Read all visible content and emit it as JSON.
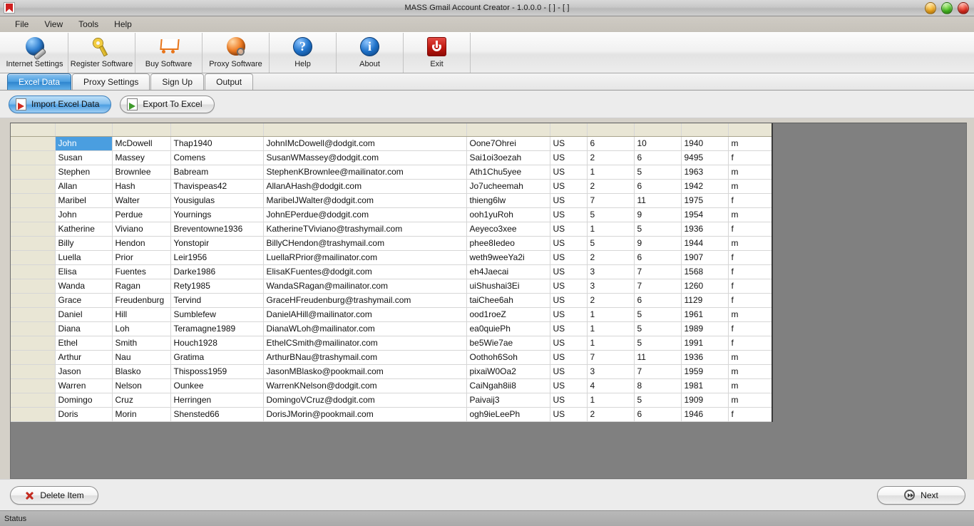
{
  "window": {
    "title": "MASS Gmail Account Creator - 1.0.0.0 - [ ] - [ ]",
    "app_icon": "gmail-envelope-icon",
    "controls": [
      {
        "name": "minimize-button",
        "color": "#f2a81c"
      },
      {
        "name": "maximize-button",
        "color": "#43bc1e"
      },
      {
        "name": "close-button",
        "color": "#e02a1c"
      }
    ]
  },
  "menubar": {
    "items": [
      {
        "label": "File"
      },
      {
        "label": "View"
      },
      {
        "label": "Tools"
      },
      {
        "label": "Help"
      }
    ]
  },
  "toolbar": {
    "buttons": [
      {
        "label": "Internet Settings",
        "icon": "globe-wrench-icon"
      },
      {
        "label": "Register Software",
        "icon": "key-icon"
      },
      {
        "label": "Buy Software",
        "icon": "shopping-cart-icon"
      },
      {
        "label": "Proxy Software",
        "icon": "globe-magnifier-icon"
      },
      {
        "label": "Help",
        "icon": "question-mark-icon",
        "glyph": "?"
      },
      {
        "label": "About",
        "icon": "info-icon",
        "glyph": "i"
      },
      {
        "label": "Exit",
        "icon": "power-icon"
      }
    ]
  },
  "tabs": [
    {
      "label": "Excel Data",
      "active": true
    },
    {
      "label": "Proxy Settings",
      "active": false
    },
    {
      "label": "Sign Up",
      "active": false
    },
    {
      "label": "Output",
      "active": false
    }
  ],
  "actionbar": {
    "import_label": "Import Excel Data",
    "export_label": "Export To Excel"
  },
  "grid": {
    "columns": [
      "",
      "",
      "",
      "",
      "",
      "",
      "",
      "",
      "",
      "",
      ""
    ],
    "selected_cell": {
      "row": 0,
      "col": 1
    },
    "rows": [
      [
        "",
        "John",
        "McDowell",
        "Thap1940",
        "JohnIMcDowell@dodgit.com",
        "Oone7Ohrei",
        "US",
        "6",
        "10",
        "1940",
        "m"
      ],
      [
        "",
        "Susan",
        "Massey",
        "Comens",
        "SusanWMassey@dodgit.com",
        "Sai1oi3oezah",
        "US",
        "2",
        "6",
        "9495",
        "f"
      ],
      [
        "",
        "Stephen",
        "Brownlee",
        "Babream",
        "StephenKBrownlee@mailinator.com",
        "Ath1Chu5yee",
        "US",
        "1",
        "5",
        "1963",
        "m"
      ],
      [
        "",
        "Allan",
        "Hash",
        "Thavispeas42",
        "AllanAHash@dodgit.com",
        "Jo7ucheemah",
        "US",
        "2",
        "6",
        "1942",
        "m"
      ],
      [
        "",
        "Maribel",
        "Walter",
        "Yousigulas",
        "MaribelJWalter@dodgit.com",
        "thieng6lw",
        "US",
        "7",
        "11",
        "1975",
        "f"
      ],
      [
        "",
        "John",
        "Perdue",
        "Yournings",
        "JohnEPerdue@dodgit.com",
        "ooh1yuRoh",
        "US",
        "5",
        "9",
        "1954",
        "m"
      ],
      [
        "",
        "Katherine",
        "Viviano",
        "Breventowne1936",
        "KatherineTViviano@trashymail.com",
        "Aeyeco3xee",
        "US",
        "1",
        "5",
        "1936",
        "f"
      ],
      [
        "",
        "Billy",
        "Hendon",
        "Yonstopir",
        "BillyCHendon@trashymail.com",
        "phee8Iedeo",
        "US",
        "5",
        "9",
        "1944",
        "m"
      ],
      [
        "",
        "Luella",
        "Prior",
        "Leir1956",
        "LuellaRPrior@mailinator.com",
        "weth9weeYa2i",
        "US",
        "2",
        "6",
        "1907",
        "f"
      ],
      [
        "",
        "Elisa",
        "Fuentes",
        "Darke1986",
        "ElisaKFuentes@dodgit.com",
        "eh4Jaecai",
        "US",
        "3",
        "7",
        "1568",
        "f"
      ],
      [
        "",
        "Wanda",
        "Ragan",
        "Rety1985",
        "WandaSRagan@mailinator.com",
        "uiShushai3Ei",
        "US",
        "3",
        "7",
        "1260",
        "f"
      ],
      [
        "",
        "Grace",
        "Freudenburg",
        "Tervind",
        "GraceHFreudenburg@trashymail.com",
        "taiChee6ah",
        "US",
        "2",
        "6",
        "1129",
        "f"
      ],
      [
        "",
        "Daniel",
        "Hill",
        "Sumblefew",
        "DanielAHill@mailinator.com",
        "ood1roeZ",
        "US",
        "1",
        "5",
        "1961",
        "m"
      ],
      [
        "",
        "Diana",
        "Loh",
        "Teramagne1989",
        "DianaWLoh@mailinator.com",
        "ea0quiePh",
        "US",
        "1",
        "5",
        "1989",
        "f"
      ],
      [
        "",
        "Ethel",
        "Smith",
        "Houch1928",
        "EthelCSmith@mailinator.com",
        "be5Wie7ae",
        "US",
        "1",
        "5",
        "1991",
        "f"
      ],
      [
        "",
        "Arthur",
        "Nau",
        "Gratima",
        "ArthurBNau@trashymail.com",
        "Oothoh6Soh",
        "US",
        "7",
        "11",
        "1936",
        "m"
      ],
      [
        "",
        "Jason",
        "Blasko",
        "Thisposs1959",
        "JasonMBlasko@pookmail.com",
        "pixaiW0Oa2",
        "US",
        "3",
        "7",
        "1959",
        "m"
      ],
      [
        "",
        "Warren",
        "Nelson",
        "Ounkee",
        "WarrenKNelson@dodgit.com",
        "CaiNgah8ii8",
        "US",
        "4",
        "8",
        "1981",
        "m"
      ],
      [
        "",
        "Domingo",
        "Cruz",
        "Herringen",
        "DomingoVCruz@dodgit.com",
        "Paivaij3",
        "US",
        "1",
        "5",
        "1909",
        "m"
      ],
      [
        "",
        "Doris",
        "Morin",
        "Shensted66",
        "DorisJMorin@pookmail.com",
        "ogh9ieLeePh",
        "US",
        "2",
        "6",
        "1946",
        "f"
      ]
    ]
  },
  "bottombar": {
    "delete_label": "Delete Item",
    "next_label": "Next"
  },
  "statusbar": {
    "text": "Status"
  }
}
